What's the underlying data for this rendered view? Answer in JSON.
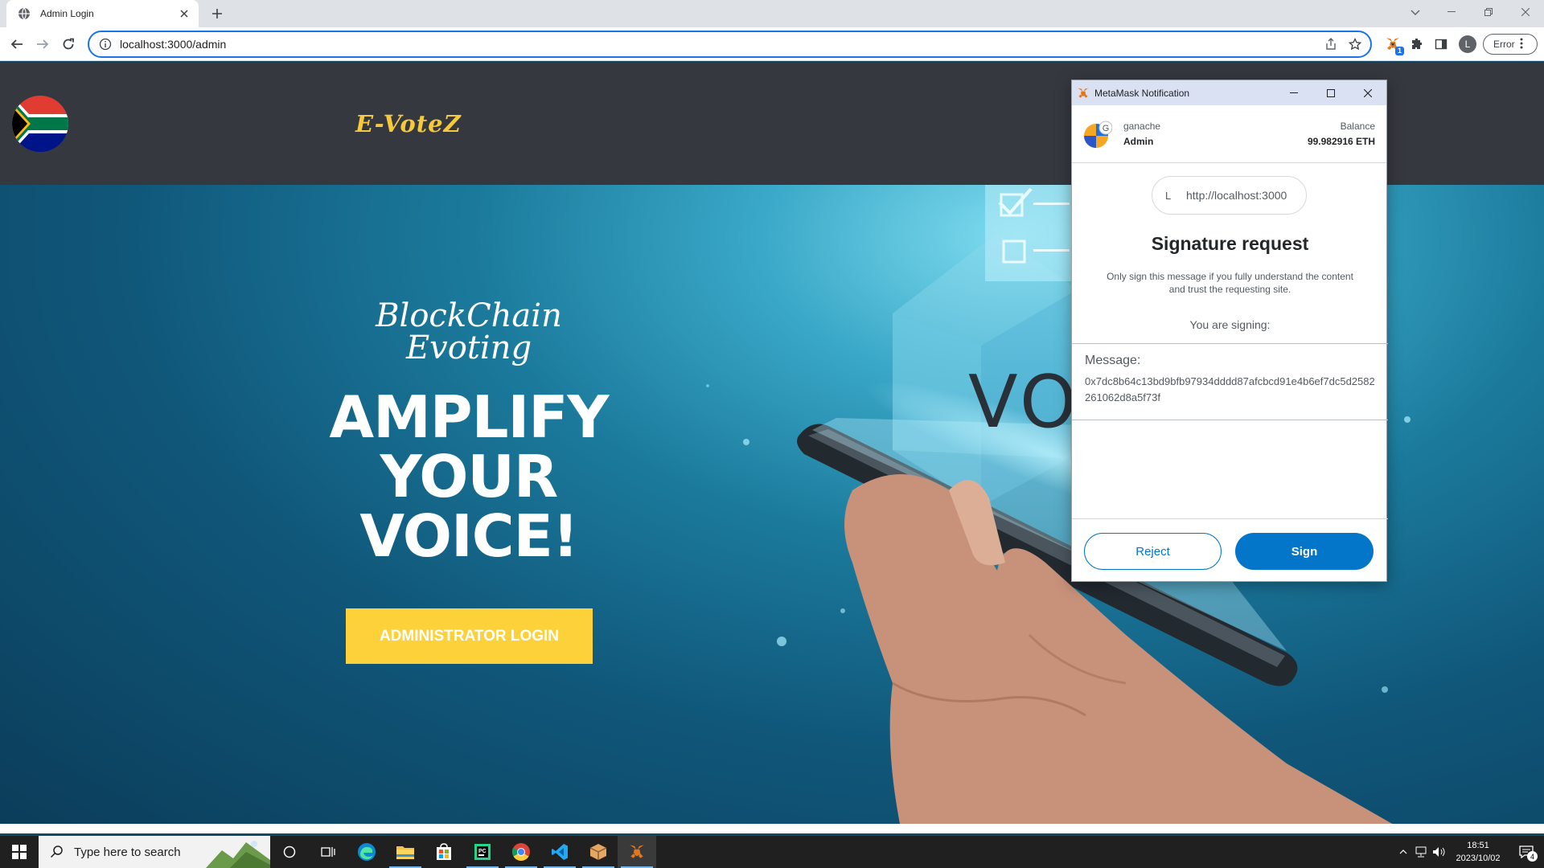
{
  "browser": {
    "tab_title": "Admin Login",
    "url": "localhost:3000/admin",
    "profile_initial": "L",
    "error_label": "Error",
    "extension_badge": "1"
  },
  "site": {
    "brand": "E-VoteZ",
    "tagline_line1": "BlockChain",
    "tagline_line2": "Evoting",
    "headline_line1": "AMPLIFY",
    "headline_line2": "YOUR",
    "headline_line3": "VOICE!",
    "admin_button": "ADMINISTRATOR LOGIN",
    "background_word": "VO"
  },
  "metamask": {
    "window_title": "MetaMask Notification",
    "network_name": "ganache",
    "network_initial": "G",
    "account_name": "Admin",
    "balance_label": "Balance",
    "balance_value": "99.982916 ETH",
    "origin_initial": "L",
    "origin": "http://localhost:3000",
    "heading": "Signature request",
    "warning": "Only sign this message if you fully understand the content and trust the requesting site.",
    "signing_label": "You are signing:",
    "message_label": "Message:",
    "message_value": "0x7dc8b64c13bd9bfb97934dddd87afcbcd91e4b6ef7dc5d2582261062d8a5f73f",
    "reject_label": "Reject",
    "sign_label": "Sign",
    "accent_color": "#0376c9"
  },
  "taskbar": {
    "search_placeholder": "Type here to search",
    "time": "18:51",
    "date": "2023/10/02",
    "notification_count": "4"
  },
  "colors": {
    "header_bg": "#363840",
    "brand_yellow": "#f5c93a",
    "button_yellow": "#fdd13a"
  }
}
